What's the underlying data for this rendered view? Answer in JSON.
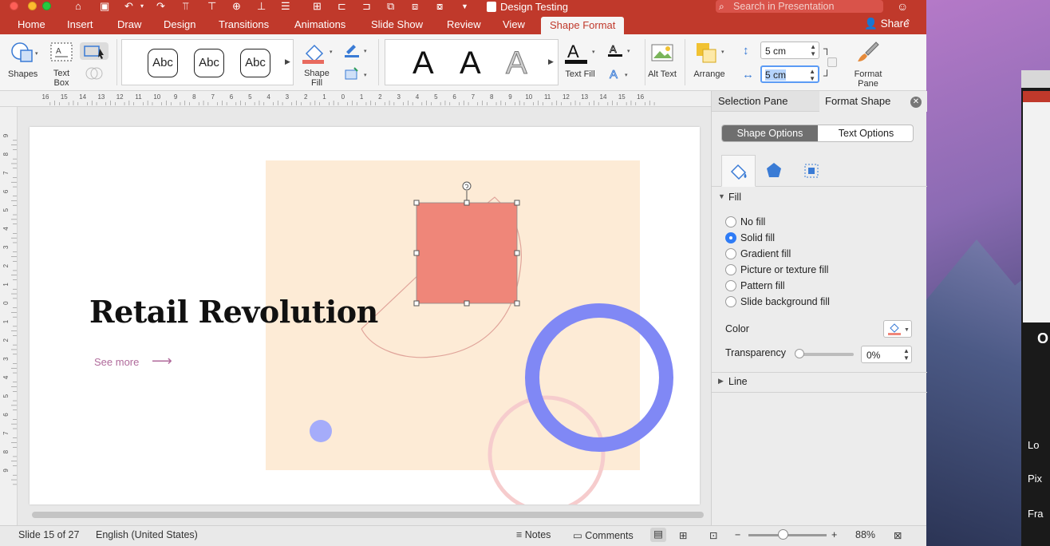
{
  "titlebar": {
    "document_title": "Design Testing",
    "search_placeholder": "Search in Presentation"
  },
  "tabs": [
    {
      "label": "Home"
    },
    {
      "label": "Insert"
    },
    {
      "label": "Draw"
    },
    {
      "label": "Design"
    },
    {
      "label": "Transitions"
    },
    {
      "label": "Animations"
    },
    {
      "label": "Slide Show"
    },
    {
      "label": "Review"
    },
    {
      "label": "View"
    },
    {
      "label": "Shape Format",
      "active": true
    }
  ],
  "share_label": "Share",
  "ribbon": {
    "shapes_label": "Shapes",
    "text_box_label": "Text Box",
    "style_samples": [
      "Abc",
      "Abc",
      "Abc"
    ],
    "shape_fill_label": "Shape Fill",
    "wordart_samples": [
      "A",
      "A",
      "A"
    ],
    "text_fill_label": "Text Fill",
    "alt_text_label": "Alt Text",
    "arrange_label": "Arrange",
    "height_value": "5 cm",
    "width_value": "5 cm",
    "format_pane_label": "Format Pane"
  },
  "ruler": {
    "top_ticks": [
      "16",
      "15",
      "14",
      "13",
      "12",
      "11",
      "10",
      "9",
      "8",
      "7",
      "6",
      "5",
      "4",
      "3",
      "2",
      "1",
      "0",
      "1",
      "2",
      "3",
      "4",
      "5",
      "6",
      "7",
      "8",
      "9",
      "10",
      "11",
      "12",
      "13",
      "14",
      "15",
      "16"
    ],
    "left_ticks": [
      "9",
      "8",
      "7",
      "6",
      "5",
      "4",
      "3",
      "2",
      "1",
      "0",
      "1",
      "2",
      "3",
      "4",
      "5",
      "6",
      "7",
      "8",
      "9"
    ]
  },
  "slide": {
    "title": "Retail Revolution",
    "link_text": "See more",
    "arrow": "⟶",
    "colors": {
      "background_panel": "#fdebd6",
      "square_fill": "#ef8679",
      "ring": "#8088f5",
      "small_circle": "#a5acfa",
      "thin_ring": "#f6cccd",
      "outline_shape": "#e0a49a"
    }
  },
  "pane": {
    "tab_selection": "Selection Pane",
    "tab_format": "Format Shape",
    "shape_options": "Shape Options",
    "text_options": "Text Options",
    "fill_header": "Fill",
    "fill_options": [
      {
        "label": "No fill",
        "selected": false
      },
      {
        "label": "Solid fill",
        "selected": true
      },
      {
        "label": "Gradient fill",
        "selected": false
      },
      {
        "label": "Picture or texture fill",
        "selected": false
      },
      {
        "label": "Pattern fill",
        "selected": false
      },
      {
        "label": "Slide background fill",
        "selected": false
      }
    ],
    "color_label": "Color",
    "transparency_label": "Transparency",
    "transparency_value": "0%",
    "transparency_level": 0,
    "line_header": "Line"
  },
  "status": {
    "slide_info": "Slide 15 of 27",
    "language": "English (United States)",
    "notes": "Notes",
    "comments": "Comments",
    "zoom": "88%"
  },
  "desktop": {
    "bg_window_partial_texts": [
      "O",
      "Lo",
      "Pix",
      "Fra"
    ]
  },
  "accent": {
    "ribbon_red": "#c0392b",
    "radio_blue": "#2f7cf6"
  }
}
